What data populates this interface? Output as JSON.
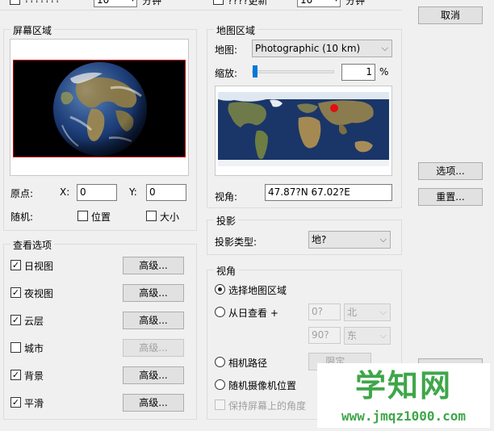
{
  "top_row": {
    "left_option_label": "???????",
    "left_spin_value": "10",
    "left_unit": "分钟",
    "right_option_label": "????更新",
    "right_spin_value": "10",
    "right_unit": "分钟"
  },
  "dialog_buttons": {
    "cancel": "取消",
    "options": "选项...",
    "reset": "重置..."
  },
  "screen_area": {
    "title": "屏幕区域",
    "origin_label": "原点:",
    "x_label": "X:",
    "x_value": "0",
    "y_label": "Y:",
    "y_value": "0",
    "random_label": "随机:",
    "position_label": "位置",
    "size_label": "大小"
  },
  "map_area": {
    "title": "地图区域",
    "map_label": "地图:",
    "map_value": "Photographic (10 km)",
    "zoom_label": "缩放:",
    "zoom_value": "1",
    "zoom_unit": "%",
    "zoom_level": 0.0,
    "view_label": "视角:",
    "view_value": "47.87?N   67.02?E"
  },
  "projection": {
    "title": "投影",
    "type_label": "投影类型:",
    "type_value": "地?"
  },
  "view_options": {
    "title": "查看选项",
    "items": [
      {
        "label": "日视图",
        "checked": true,
        "button": "高级...",
        "button_enabled": true
      },
      {
        "label": "夜视图",
        "checked": true,
        "button": "高级...",
        "button_enabled": true
      },
      {
        "label": "云层",
        "checked": true,
        "button": "高级...",
        "button_enabled": true
      },
      {
        "label": "城市",
        "checked": false,
        "button": "高级...",
        "button_enabled": false
      },
      {
        "label": "背景",
        "checked": true,
        "button": "高级...",
        "button_enabled": true
      },
      {
        "label": "平滑",
        "checked": true,
        "button": "高级...",
        "button_enabled": true
      }
    ]
  },
  "viewpoint": {
    "title": "视角",
    "opt_select_map": "选择地图区域",
    "opt_view_from_sun": "从日查看 +",
    "lat_value": "0?",
    "lat_dir": "北",
    "lon_value": "90?",
    "lon_dir": "东",
    "opt_camera_path": "相机路径",
    "camera_path_button": "限定...",
    "opt_random_camera": "随机摄像机位置",
    "keep_screen_angle": "保持屏幕上的角度"
  },
  "watermark": {
    "title": "学知网",
    "url": "www.jmqz1000.com"
  },
  "colors": {
    "accent": "#0078d7",
    "marker": "#e01010",
    "watermark_green": "#3fa64a"
  }
}
